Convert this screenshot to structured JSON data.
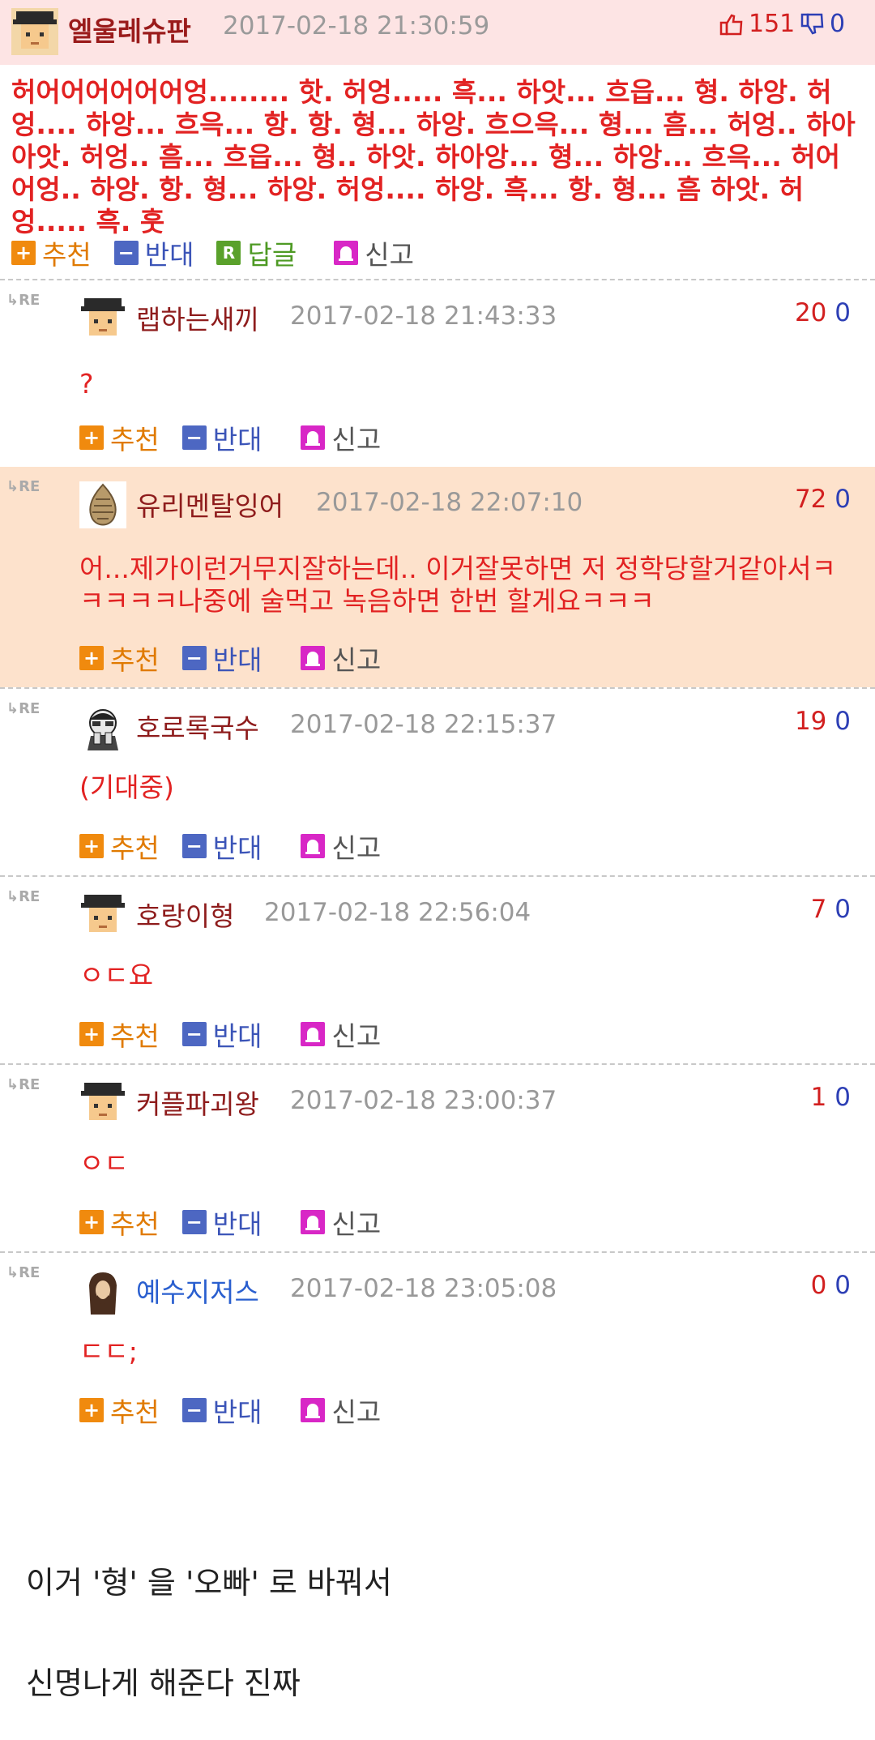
{
  "post": {
    "author": "엘울레슈판",
    "date": "2017-02-18 21:30:59",
    "likes": "151",
    "dislikes": "0",
    "body": "허어어어어어어엉........ 핫. 허엉..... 흑... 하앗... 흐읍... 형. 하앙. 허엉.... 하앙... 흐윽... 항. 항. 형... 하앙. 흐으윽... 형... 흠... 허엉.. 하아아앗. 허엉.. 흠... 흐읍... 형.. 하앗. 하아앙... 형... 하앙... 흐윽... 허어어엉.. 하앙. 항. 형... 하앙. 허엉.... 하앙. 흑... 항. 형... 흠 하앗. 허엉..... 흑. 훗",
    "actions": {
      "recommend": "추천",
      "oppose": "반대",
      "reply": "답글",
      "report": "신고"
    }
  },
  "re_label": "RE",
  "comments": [
    {
      "author": "랩하는새끼",
      "date": "2017-02-18 21:43:33",
      "up": "20",
      "down": "0",
      "text": "?"
    },
    {
      "author": "유리멘탈잉어",
      "date": "2017-02-18 22:07:10",
      "up": "72",
      "down": "0",
      "text": "어...제가이런거무지잘하는데.. 이거잘못하면 저 정학당할거같아서ㅋㅋㅋㅋㅋ나중에 술먹고 녹음하면 한번 할게요ㅋㅋㅋ"
    },
    {
      "author": "호로록국수",
      "date": "2017-02-18 22:15:37",
      "up": "19",
      "down": "0",
      "text": "(기대중)"
    },
    {
      "author": "호랑이형",
      "date": "2017-02-18 22:56:04",
      "up": "7",
      "down": "0",
      "text": "ㅇㄷ요"
    },
    {
      "author": "커플파괴왕",
      "date": "2017-02-18 23:00:37",
      "up": "1",
      "down": "0",
      "text": "ㅇㄷ"
    },
    {
      "author": "예수지저스",
      "date": "2017-02-18 23:05:08",
      "up": "0",
      "down": "0",
      "text": "ㄷㄷ;"
    }
  ],
  "comment_actions": {
    "recommend": "추천",
    "oppose": "반대",
    "report": "신고"
  },
  "captions": [
    "이거 '형' 을 '오빠' 로 바꿔서",
    "신명나게 해준다 진짜"
  ]
}
